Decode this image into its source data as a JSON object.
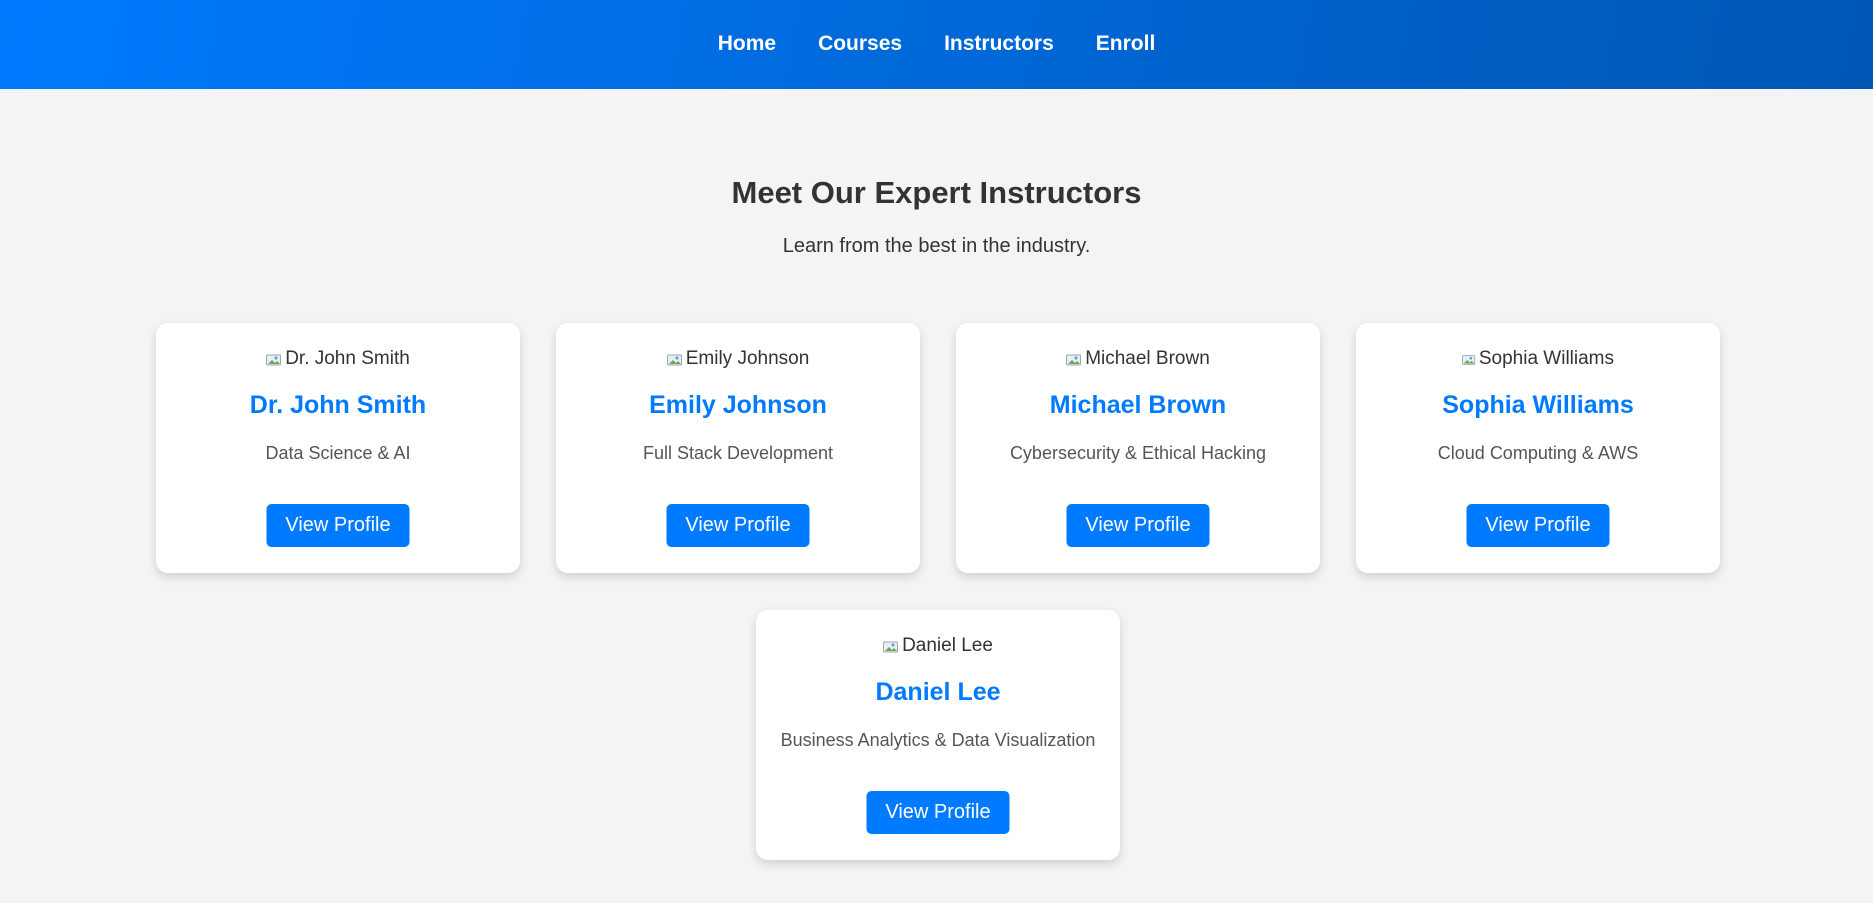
{
  "nav": {
    "items": [
      {
        "label": "Home"
      },
      {
        "label": "Courses"
      },
      {
        "label": "Instructors"
      },
      {
        "label": "Enroll"
      }
    ]
  },
  "hero": {
    "title": "Meet Our Expert Instructors",
    "subtitle": "Learn from the best in the industry."
  },
  "instructors": [
    {
      "photo_alt": "Dr. John Smith",
      "name": "Dr. John Smith",
      "specialty": "Data Science & AI",
      "button": "View Profile"
    },
    {
      "photo_alt": "Emily Johnson",
      "name": "Emily Johnson",
      "specialty": "Full Stack Development",
      "button": "View Profile"
    },
    {
      "photo_alt": "Michael Brown",
      "name": "Michael Brown",
      "specialty": "Cybersecurity & Ethical Hacking",
      "button": "View Profile"
    },
    {
      "photo_alt": "Sophia Williams",
      "name": "Sophia Williams",
      "specialty": "Cloud Computing & AWS",
      "button": "View Profile"
    },
    {
      "photo_alt": "Daniel Lee",
      "name": "Daniel Lee",
      "specialty": "Business Analytics & Data Visualization",
      "button": "View Profile"
    }
  ],
  "colors": {
    "accent": "#007bff",
    "accent_dark": "#0056b3",
    "background": "#f4f4f4"
  },
  "icons": {
    "photo_placeholder": "broken-image-icon"
  }
}
